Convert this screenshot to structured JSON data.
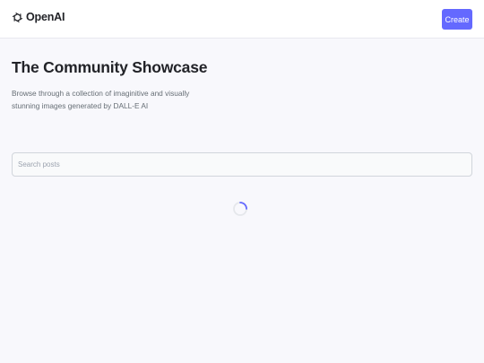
{
  "header": {
    "logo_text": "OpenAI",
    "create_label": "Create"
  },
  "main": {
    "title": "The Community Showcase",
    "subtitle": "Browse through a collection of imaginitive and visually stunning images generated by DALL-E AI",
    "search": {
      "placeholder": "Search posts",
      "value": ""
    }
  },
  "colors": {
    "accent": "#6469ff",
    "background": "#f8f8fc",
    "text": "#222328",
    "muted": "#666e75"
  },
  "icons": {
    "logo": "openai-logo-icon",
    "loader": "loading-spinner-icon"
  }
}
